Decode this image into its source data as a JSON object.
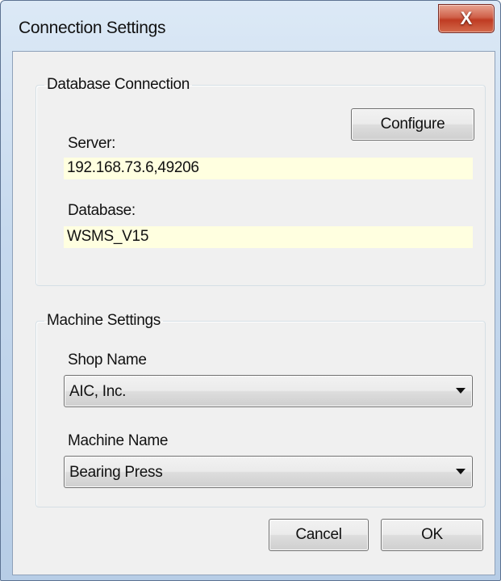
{
  "window": {
    "title": "Connection Settings",
    "close_label": "X"
  },
  "database_group": {
    "legend": "Database Connection",
    "configure_label": "Configure",
    "server_label": "Server:",
    "server_value": "192.168.73.6,49206",
    "database_label": "Database:",
    "database_value": "WSMS_V15"
  },
  "machine_group": {
    "legend": "Machine Settings",
    "shop_label": "Shop Name",
    "shop_value": "AIC, Inc.",
    "machine_label": "Machine Name",
    "machine_value": "Bearing Press"
  },
  "buttons": {
    "cancel": "Cancel",
    "ok": "OK"
  },
  "colors": {
    "readonly_field_bg": "#ffffe0",
    "close_button": "#c44a33"
  }
}
